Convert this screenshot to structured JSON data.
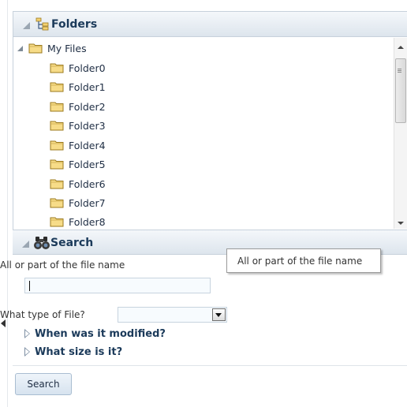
{
  "folders_panel": {
    "title": "Folders",
    "root": "My Files",
    "folders": [
      "Folder0",
      "Folder1",
      "Folder2",
      "Folder3",
      "Folder4",
      "Folder5",
      "Folder6",
      "Folder7",
      "Folder8"
    ]
  },
  "search_panel": {
    "title": "Search",
    "filename_label": "All or part of the file name",
    "filename_value": "",
    "tooltip": "All or part of the file name",
    "type_label": "What type of File?",
    "type_value": "",
    "modified_label": "When was it modified?",
    "size_label": "What size is it?",
    "search_button": "Search"
  },
  "colors": {
    "header_text": "#1b3a5a",
    "folder_fill": "#f7dc88",
    "accent": "#7d8fa3"
  },
  "icons": {
    "folders_header": "folder-tree-icon",
    "search_header": "binoculars-icon",
    "folder": "folder-icon",
    "collapse": "collapse-triangle-icon"
  }
}
